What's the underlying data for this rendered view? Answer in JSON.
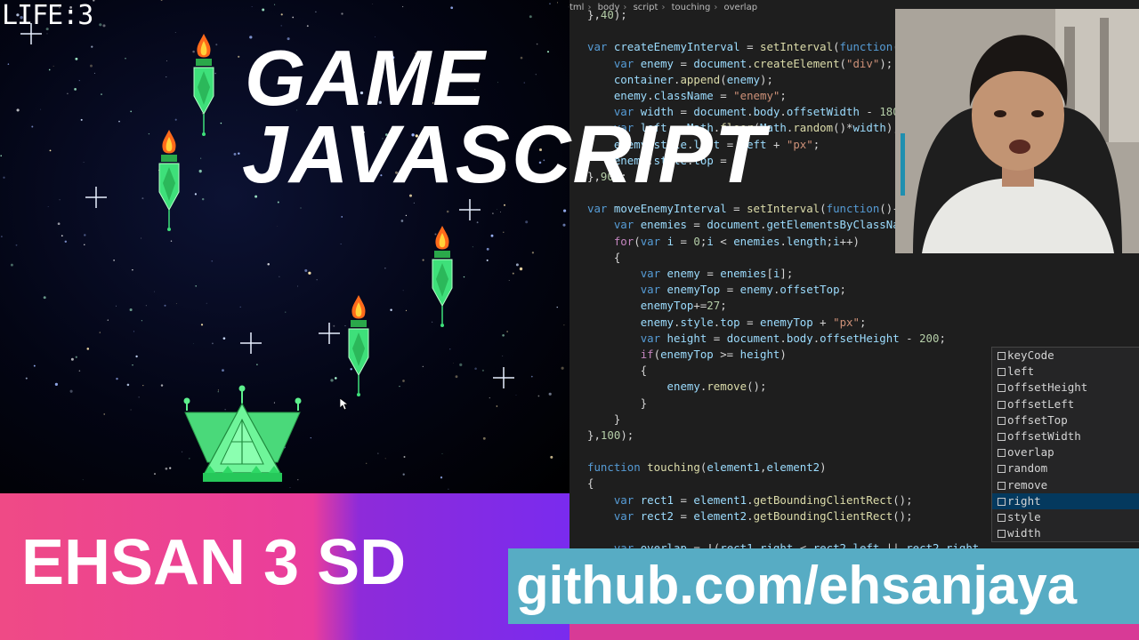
{
  "game": {
    "life_label": "LIFE:3"
  },
  "overlay": {
    "title_line1": "GAME",
    "title_line2": "JAVASCRIPT",
    "author": "EHSAN 3 SD",
    "github": "github.com/ehsanjaya"
  },
  "editor": {
    "breadcrumbs": [
      "tml",
      "body",
      "script",
      "touching",
      "overlap"
    ],
    "code_lines": [
      "},40);",
      "",
      "var createEnemyInterval = setInterval(function(",
      "    var enemy = document.createElement(\"div\");",
      "    container.append(enemy);",
      "    enemy.className = \"enemy\";",
      "    var width = document.body.offsetWidth - 180",
      "    var left = Math.floor(Math.random()*width);",
      "    enemy.style.left = left + \"px\";",
      "    enemy.style.top = 0;",
      "},90);",
      "",
      "var moveEnemyInterval = setInterval(function(){",
      "    var enemies = document.getElementsByClassNa",
      "    for(var i = 0;i < enemies.length;i++)",
      "    {",
      "        var enemy = enemies[i];",
      "        var enemyTop = enemy.offsetTop;",
      "        enemyTop+=27;",
      "        enemy.style.top = enemyTop + \"px\";",
      "        var height = document.body.offsetHeight - 200;",
      "        if(enemyTop >= height)",
      "        {",
      "            enemy.remove();",
      "        }",
      "    }",
      "},100);",
      "",
      "function touching(element1,element2)",
      "{",
      "    var rect1 = element1.getBoundingClientRect();",
      "    var rect2 = element2.getBoundingClientRect();",
      "",
      "    var overlap = !(rect1.right < rect2.left || rect2.right"
    ],
    "suggestions": [
      "keyCode",
      "left",
      "offsetHeight",
      "offsetLeft",
      "offsetTop",
      "offsetWidth",
      "overlap",
      "random",
      "remove",
      "right",
      "style",
      "width"
    ],
    "selected_suggestion": "right"
  },
  "colors": {
    "banner_pink": "#ef4a86",
    "banner_purple": "#7a2bee",
    "github_box": "#57acc4",
    "enemy_green": "#3ee07a",
    "player_green": "#5df08c"
  }
}
